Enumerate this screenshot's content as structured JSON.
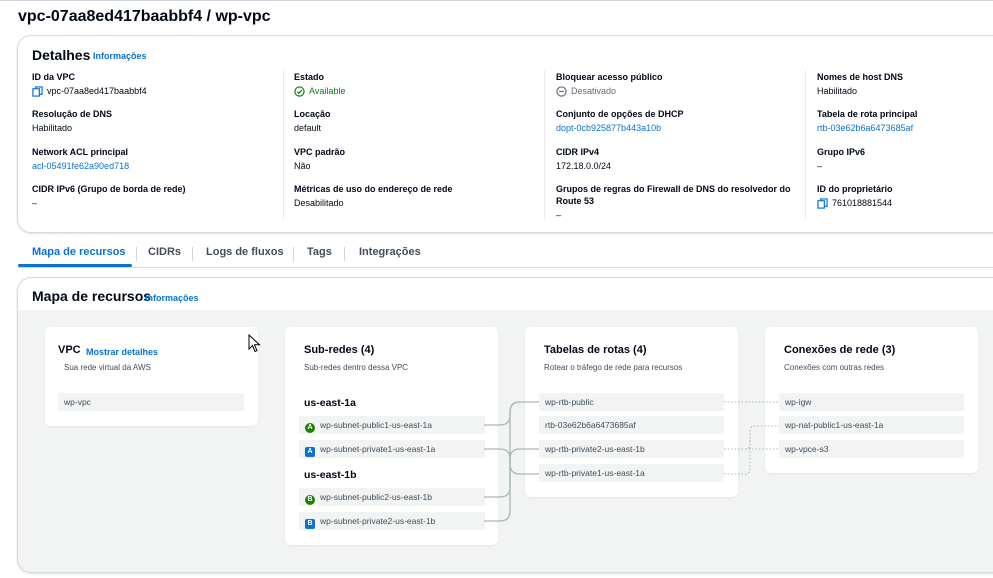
{
  "header": {
    "title": "vpc-07aa8ed417baabbf4 / wp-vpc"
  },
  "details": {
    "title": "Detalhes",
    "info_label": "Informações",
    "fields": [
      {
        "label": "ID da VPC",
        "value": "vpc-07aa8ed417baabbf4"
      },
      {
        "label": "Estado",
        "value": "Available"
      },
      {
        "label": "Bloquear acesso público",
        "value": "Desativado"
      },
      {
        "label": "Nomes de host DNS",
        "value": "Habilitado"
      },
      {
        "label": "Resolução de DNS",
        "value": "Habilitado"
      },
      {
        "label": "Locação",
        "value": "default"
      },
      {
        "label": "Conjunto de opções de DHCP",
        "value": "dopt-0cb925877b443a10b"
      },
      {
        "label": "Tabela de rota principal",
        "value": "rtb-03e62b6a6473685af"
      },
      {
        "label": "Network ACL principal",
        "value": "acl-05491fe62a90ed718"
      },
      {
        "label": "VPC padrão",
        "value": "Não"
      },
      {
        "label": "CIDR IPv4",
        "value": "172.18.0.0/24"
      },
      {
        "label": "Grupo IPv6",
        "value": "–"
      },
      {
        "label": "CIDR IPv6 (Grupo de borda de rede)",
        "value": "–"
      },
      {
        "label": "Métricas de uso do endereço de rede",
        "value": "Desabilitado"
      },
      {
        "label": "Grupos de regras do Firewall de DNS do resolvedor do Route 53",
        "value": "–"
      },
      {
        "label": "ID do proprietário",
        "value": "761018881544"
      }
    ]
  },
  "tabs": [
    "Mapa de recursos",
    "CIDRs",
    "Logs de fluxos",
    "Tags",
    "Integrações"
  ],
  "resource_map": {
    "title": "Mapa de recursos",
    "info_label": "Informações",
    "vpc": {
      "title": "VPC",
      "show_details": "Mostrar detalhes",
      "subtitle": "Sua rede virtual da AWS",
      "item": "wp-vpc"
    },
    "subnets": {
      "title": "Sub-redes (4)",
      "subtitle": "Sub-redes dentro dessa VPC",
      "az1": "us-east-1a",
      "az1_items": [
        "wp-subnet-public1-us-east-1a",
        "wp-subnet-private1-us-east-1a"
      ],
      "az2": "us-east-1b",
      "az2_items": [
        "wp-subnet-public2-us-east-1b",
        "wp-subnet-private2-us-east-1b"
      ],
      "badges": {
        "public1": "A",
        "private1": "A",
        "public2": "B",
        "private2": "B"
      }
    },
    "route_tables": {
      "title": "Tabelas de rotas (4)",
      "subtitle": "Rotear o tráfego de rede para recursos",
      "items": [
        "wp-rtb-public",
        "rtb-03e62b6a6473685af",
        "wp-rtb-private2-us-east-1b",
        "wp-rtb-private1-us-east-1a"
      ]
    },
    "connections": {
      "title": "Conexões de rede (3)",
      "subtitle": "Conexões com outras redes",
      "items": [
        "wp-igw",
        "wp-nat-public1-us-east-1a",
        "wp-vpce-s3"
      ]
    }
  },
  "colors": {
    "link": "#0972d3",
    "available": "#037f0c",
    "public_badge": "#1d8102",
    "private_badge": "#0972d3"
  },
  "icons": {
    "copy": "copy-icon",
    "status": "check-circle-icon",
    "disabled": "minus-circle-icon"
  }
}
